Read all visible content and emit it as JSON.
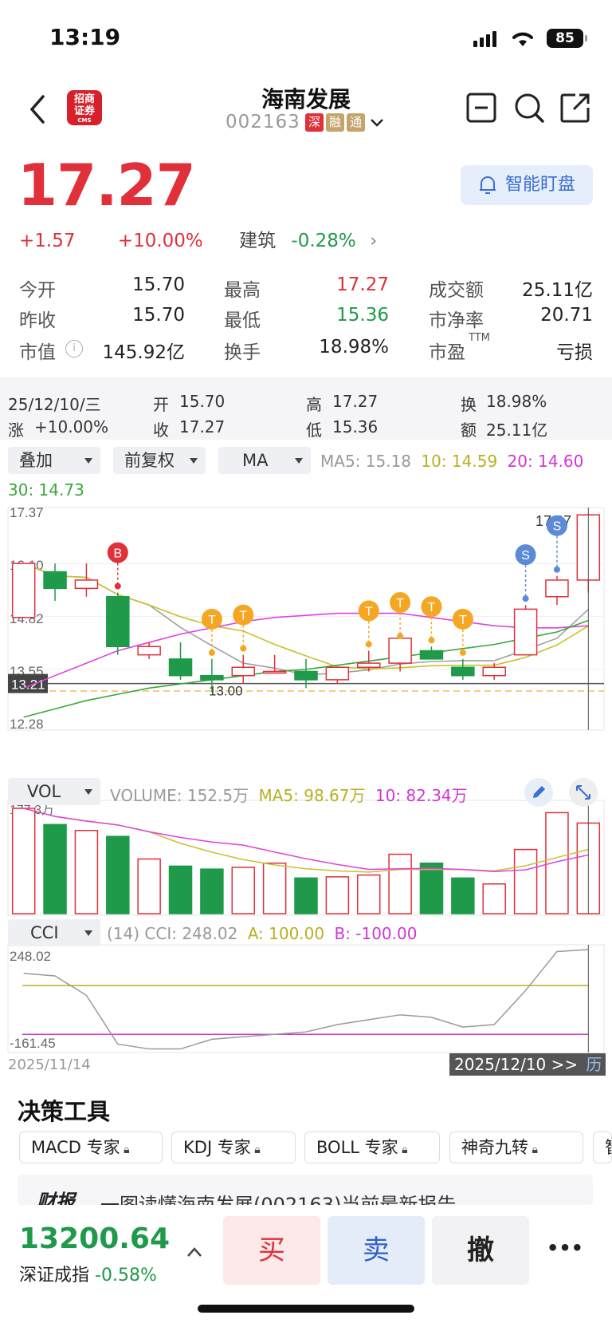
{
  "status_bar": {
    "time": "13:19",
    "battery": "85"
  },
  "header": {
    "title": "海南发展",
    "code": "002163",
    "tags": [
      "深",
      "融",
      "通"
    ],
    "logo_text": "招商证券",
    "logo_sub": "CMS"
  },
  "quote": {
    "price": "17.27",
    "change": "+1.57",
    "change_pct": "+10.00%",
    "sector": "建筑",
    "sector_pct": "-0.28%",
    "smart_button": "智能盯盘"
  },
  "stats": [
    {
      "label": "今开",
      "value": "15.70"
    },
    {
      "label": "最高",
      "value": "17.27"
    },
    {
      "label": "成交额",
      "value": "25.11亿"
    },
    {
      "label": "昨收",
      "value": "15.70"
    },
    {
      "label": "最低",
      "value": "15.36"
    },
    {
      "label": "市净率",
      "value": "20.71"
    },
    {
      "label": "市值",
      "value": "145.92亿"
    },
    {
      "label": "换手",
      "value": "18.98%"
    },
    {
      "label": "市盈",
      "value": "亏损",
      "sup": "TTM"
    }
  ],
  "day": {
    "date": "25/12/10/三",
    "open_l": "开",
    "open": "15.70",
    "high_l": "高",
    "high": "17.27",
    "turn_l": "换",
    "turn": "18.98%",
    "chg_l": "涨",
    "chg": "+10.00%",
    "close_l": "收",
    "close": "17.27",
    "low_l": "低",
    "low": "15.36",
    "amt_l": "额",
    "amt": "25.11亿"
  },
  "controls": {
    "overlay": "叠加",
    "adjust": "前复权",
    "ma": "MA"
  },
  "ma_legend": {
    "ma5": "MA5: 15.18",
    "ma10": "10: 14.59",
    "ma20": "20: 14.60",
    "ma30": "30: 14.73"
  },
  "price_axis": [
    "17.37",
    "16.10",
    "14.82",
    "13.55",
    "12.28"
  ],
  "price_tags": {
    "current_line": "13.21",
    "dashed_line": "13.20",
    "low_label": "13.00",
    "high_label": "17.27"
  },
  "vol": {
    "label": "VOL",
    "volume": "VOLUME: 152.5万",
    "ma5": "MA5: 98.67万",
    "ma10": "10: 82.34万",
    "axis_max": "177.3万"
  },
  "cci": {
    "label": "CCI",
    "params": "(14) CCI: 248.02",
    "a": "A: 100.00",
    "b": "B: -100.00",
    "axis_max": "248.02",
    "axis_min": "-161.45",
    "date_start": "2025/11/14",
    "date_end": "2025/12/10 >>",
    "hist": "历"
  },
  "chart_data": {
    "type": "candlestick",
    "candles": [
      {
        "o": 14.8,
        "h": 16.1,
        "l": 14.8,
        "c": 16.1
      },
      {
        "o": 15.9,
        "h": 16.1,
        "l": 15.2,
        "c": 15.5
      },
      {
        "o": 15.5,
        "h": 16.1,
        "l": 15.3,
        "c": 15.7
      },
      {
        "o": 15.3,
        "h": 15.4,
        "l": 13.9,
        "c": 14.1
      },
      {
        "o": 13.9,
        "h": 14.2,
        "l": 13.8,
        "c": 14.1
      },
      {
        "o": 13.8,
        "h": 14.2,
        "l": 13.3,
        "c": 13.4
      },
      {
        "o": 13.4,
        "h": 13.8,
        "l": 13.0,
        "c": 13.3
      },
      {
        "o": 13.4,
        "h": 13.9,
        "l": 13.2,
        "c": 13.6
      },
      {
        "o": 13.5,
        "h": 13.9,
        "l": 13.5,
        "c": 13.5
      },
      {
        "o": 13.5,
        "h": 13.8,
        "l": 13.1,
        "c": 13.3
      },
      {
        "o": 13.3,
        "h": 13.6,
        "l": 13.2,
        "c": 13.6
      },
      {
        "o": 13.6,
        "h": 14.0,
        "l": 13.5,
        "c": 13.7
      },
      {
        "o": 13.7,
        "h": 14.2,
        "l": 13.5,
        "c": 14.3
      },
      {
        "o": 14.0,
        "h": 14.1,
        "l": 13.8,
        "c": 13.8
      },
      {
        "o": 13.6,
        "h": 13.8,
        "l": 13.3,
        "c": 13.4
      },
      {
        "o": 13.4,
        "h": 13.7,
        "l": 13.3,
        "c": 13.6
      },
      {
        "o": 13.9,
        "h": 15.1,
        "l": 13.9,
        "c": 15.0
      },
      {
        "o": 15.3,
        "h": 15.8,
        "l": 15.1,
        "c": 15.7
      },
      {
        "o": 15.7,
        "h": 17.3,
        "l": 15.4,
        "c": 17.27
      }
    ],
    "volumes": [
      177.3,
      150,
      140,
      130,
      92,
      80,
      75,
      78,
      85,
      60,
      62,
      65,
      100,
      85,
      60,
      50,
      108,
      170,
      152.5
    ],
    "cci_values": [
      150,
      140,
      60,
      -140,
      -160,
      -160,
      -120,
      -110,
      -100,
      -90,
      -60,
      -40,
      -20,
      -30,
      -70,
      -60,
      80,
      240,
      248.02
    ],
    "cci_ylim": [
      -161.45,
      248.02
    ],
    "price_ylim": [
      12.28,
      17.37
    ],
    "signals": [
      {
        "i": 3,
        "t": "B"
      },
      {
        "i": 6,
        "t": "T"
      },
      {
        "i": 7,
        "t": "T"
      },
      {
        "i": 11,
        "t": "T"
      },
      {
        "i": 12,
        "t": "T"
      },
      {
        "i": 13,
        "t": "T"
      },
      {
        "i": 14,
        "t": "T"
      },
      {
        "i": 16,
        "t": "S"
      },
      {
        "i": 17,
        "t": "S"
      }
    ],
    "colors": {
      "up": "#e0303a",
      "down": "#1f9a4a",
      "ma5": "#a0a0a0",
      "ma10": "#c8c030",
      "ma20": "#e040e0",
      "ma30": "#3aa83a",
      "signal_t": "#f5a623",
      "signal_b": "#e0303a",
      "signal_s": "#5b8ad6"
    }
  },
  "tools": {
    "title": "决策工具",
    "chips": [
      "MACD 专家",
      "KDJ 专家",
      "BOLL 专家",
      "神奇九转",
      "智"
    ]
  },
  "report": {
    "tag": "财报",
    "text": "一图读懂海南发展(002163)当前最新报告"
  },
  "bottom": {
    "index_value": "13200.64",
    "index_name": "深证成指",
    "index_pct": "-0.58%",
    "buy": "买",
    "sell": "卖",
    "cancel": "撤",
    "more": "•••"
  }
}
